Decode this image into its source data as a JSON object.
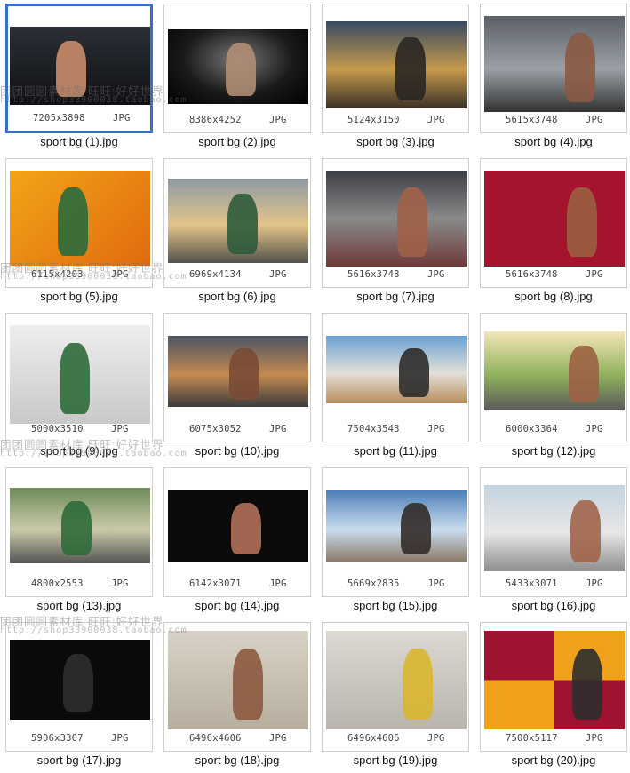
{
  "thumbnails": [
    {
      "filename": "sport bg (1).jpg",
      "dimensions": "7205x3898",
      "type": "JPG",
      "selected": true
    },
    {
      "filename": "sport bg (2).jpg",
      "dimensions": "8386x4252",
      "type": "JPG"
    },
    {
      "filename": "sport bg (3).jpg",
      "dimensions": "5124x3150",
      "type": "JPG"
    },
    {
      "filename": "sport bg (4).jpg",
      "dimensions": "5615x3748",
      "type": "JPG"
    },
    {
      "filename": "sport bg (5).jpg",
      "dimensions": "6115x4203",
      "type": "JPG"
    },
    {
      "filename": "sport bg (6).jpg",
      "dimensions": "6969x4134",
      "type": "JPG"
    },
    {
      "filename": "sport bg (7).jpg",
      "dimensions": "5616x3748",
      "type": "JPG"
    },
    {
      "filename": "sport bg (8).jpg",
      "dimensions": "5616x3748",
      "type": "JPG"
    },
    {
      "filename": "sport bg (9).jpg",
      "dimensions": "5000x3510",
      "type": "JPG"
    },
    {
      "filename": "sport bg (10).jpg",
      "dimensions": "6075x3052",
      "type": "JPG"
    },
    {
      "filename": "sport bg (11).jpg",
      "dimensions": "7504x3543",
      "type": "JPG"
    },
    {
      "filename": "sport bg (12).jpg",
      "dimensions": "6000x3364",
      "type": "JPG"
    },
    {
      "filename": "sport bg (13).jpg",
      "dimensions": "4800x2553",
      "type": "JPG"
    },
    {
      "filename": "sport bg (14).jpg",
      "dimensions": "6142x3071",
      "type": "JPG"
    },
    {
      "filename": "sport bg (15).jpg",
      "dimensions": "5669x2835",
      "type": "JPG"
    },
    {
      "filename": "sport bg (16).jpg",
      "dimensions": "5433x3071",
      "type": "JPG"
    },
    {
      "filename": "sport bg (17).jpg",
      "dimensions": "5906x3307",
      "type": "JPG"
    },
    {
      "filename": "sport bg (18).jpg",
      "dimensions": "6496x4606",
      "type": "JPG"
    },
    {
      "filename": "sport bg (19).jpg",
      "dimensions": "6496x4606",
      "type": "JPG"
    },
    {
      "filename": "sport bg (20).jpg",
      "dimensions": "7500x5117",
      "type": "JPG"
    }
  ],
  "watermark": {
    "text": "团团圆圆素材库    旺旺:好好世界",
    "url": "http://shop33900038.taobao.com"
  },
  "colors": {
    "selection_border": "#3a6fc4",
    "tile_border": "#cfcfcf"
  }
}
